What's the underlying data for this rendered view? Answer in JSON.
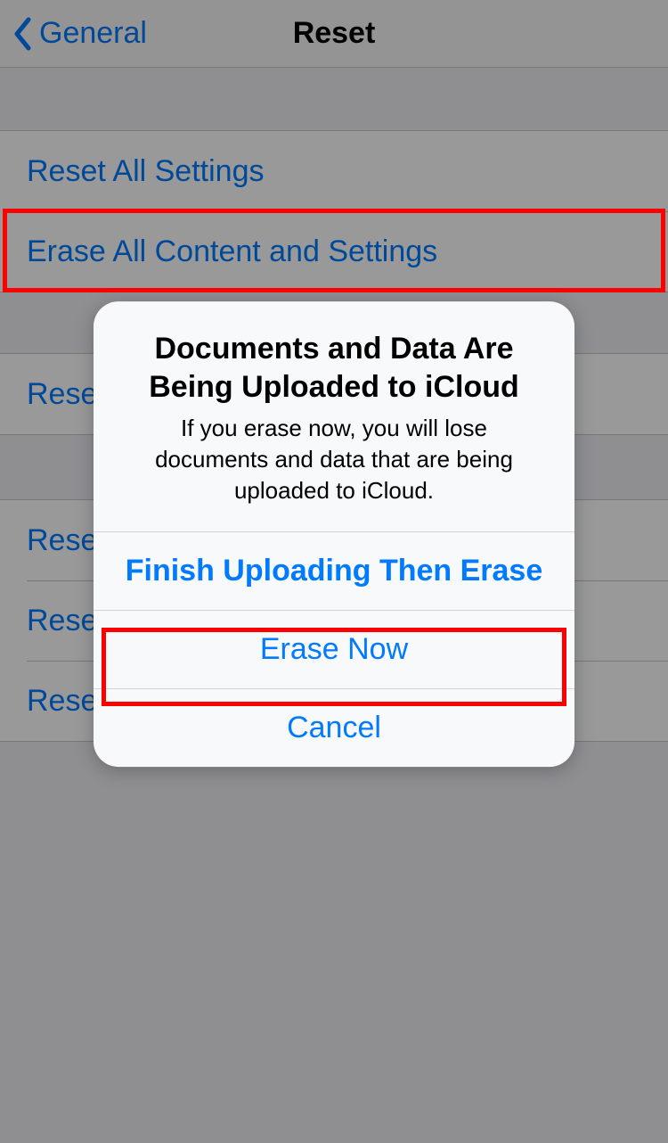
{
  "nav": {
    "back_label": "General",
    "title": "Reset"
  },
  "list": {
    "reset_all_settings": "Reset All Settings",
    "erase_all_content": "Erase All Content and Settings",
    "reset_network": "Reset Network Settings",
    "reset_keyboard": "Reset Keyboard Dictionary",
    "reset_home": "Reset Home Screen Layout",
    "reset_location": "Reset Location & Privacy"
  },
  "alert": {
    "title": "Documents and Data Are Being Uploaded to iCloud",
    "message": "If you erase now, you will lose documents and data that are being uploaded to iCloud.",
    "finish_then_erase": "Finish Uploading Then Erase",
    "erase_now": "Erase Now",
    "cancel": "Cancel"
  }
}
